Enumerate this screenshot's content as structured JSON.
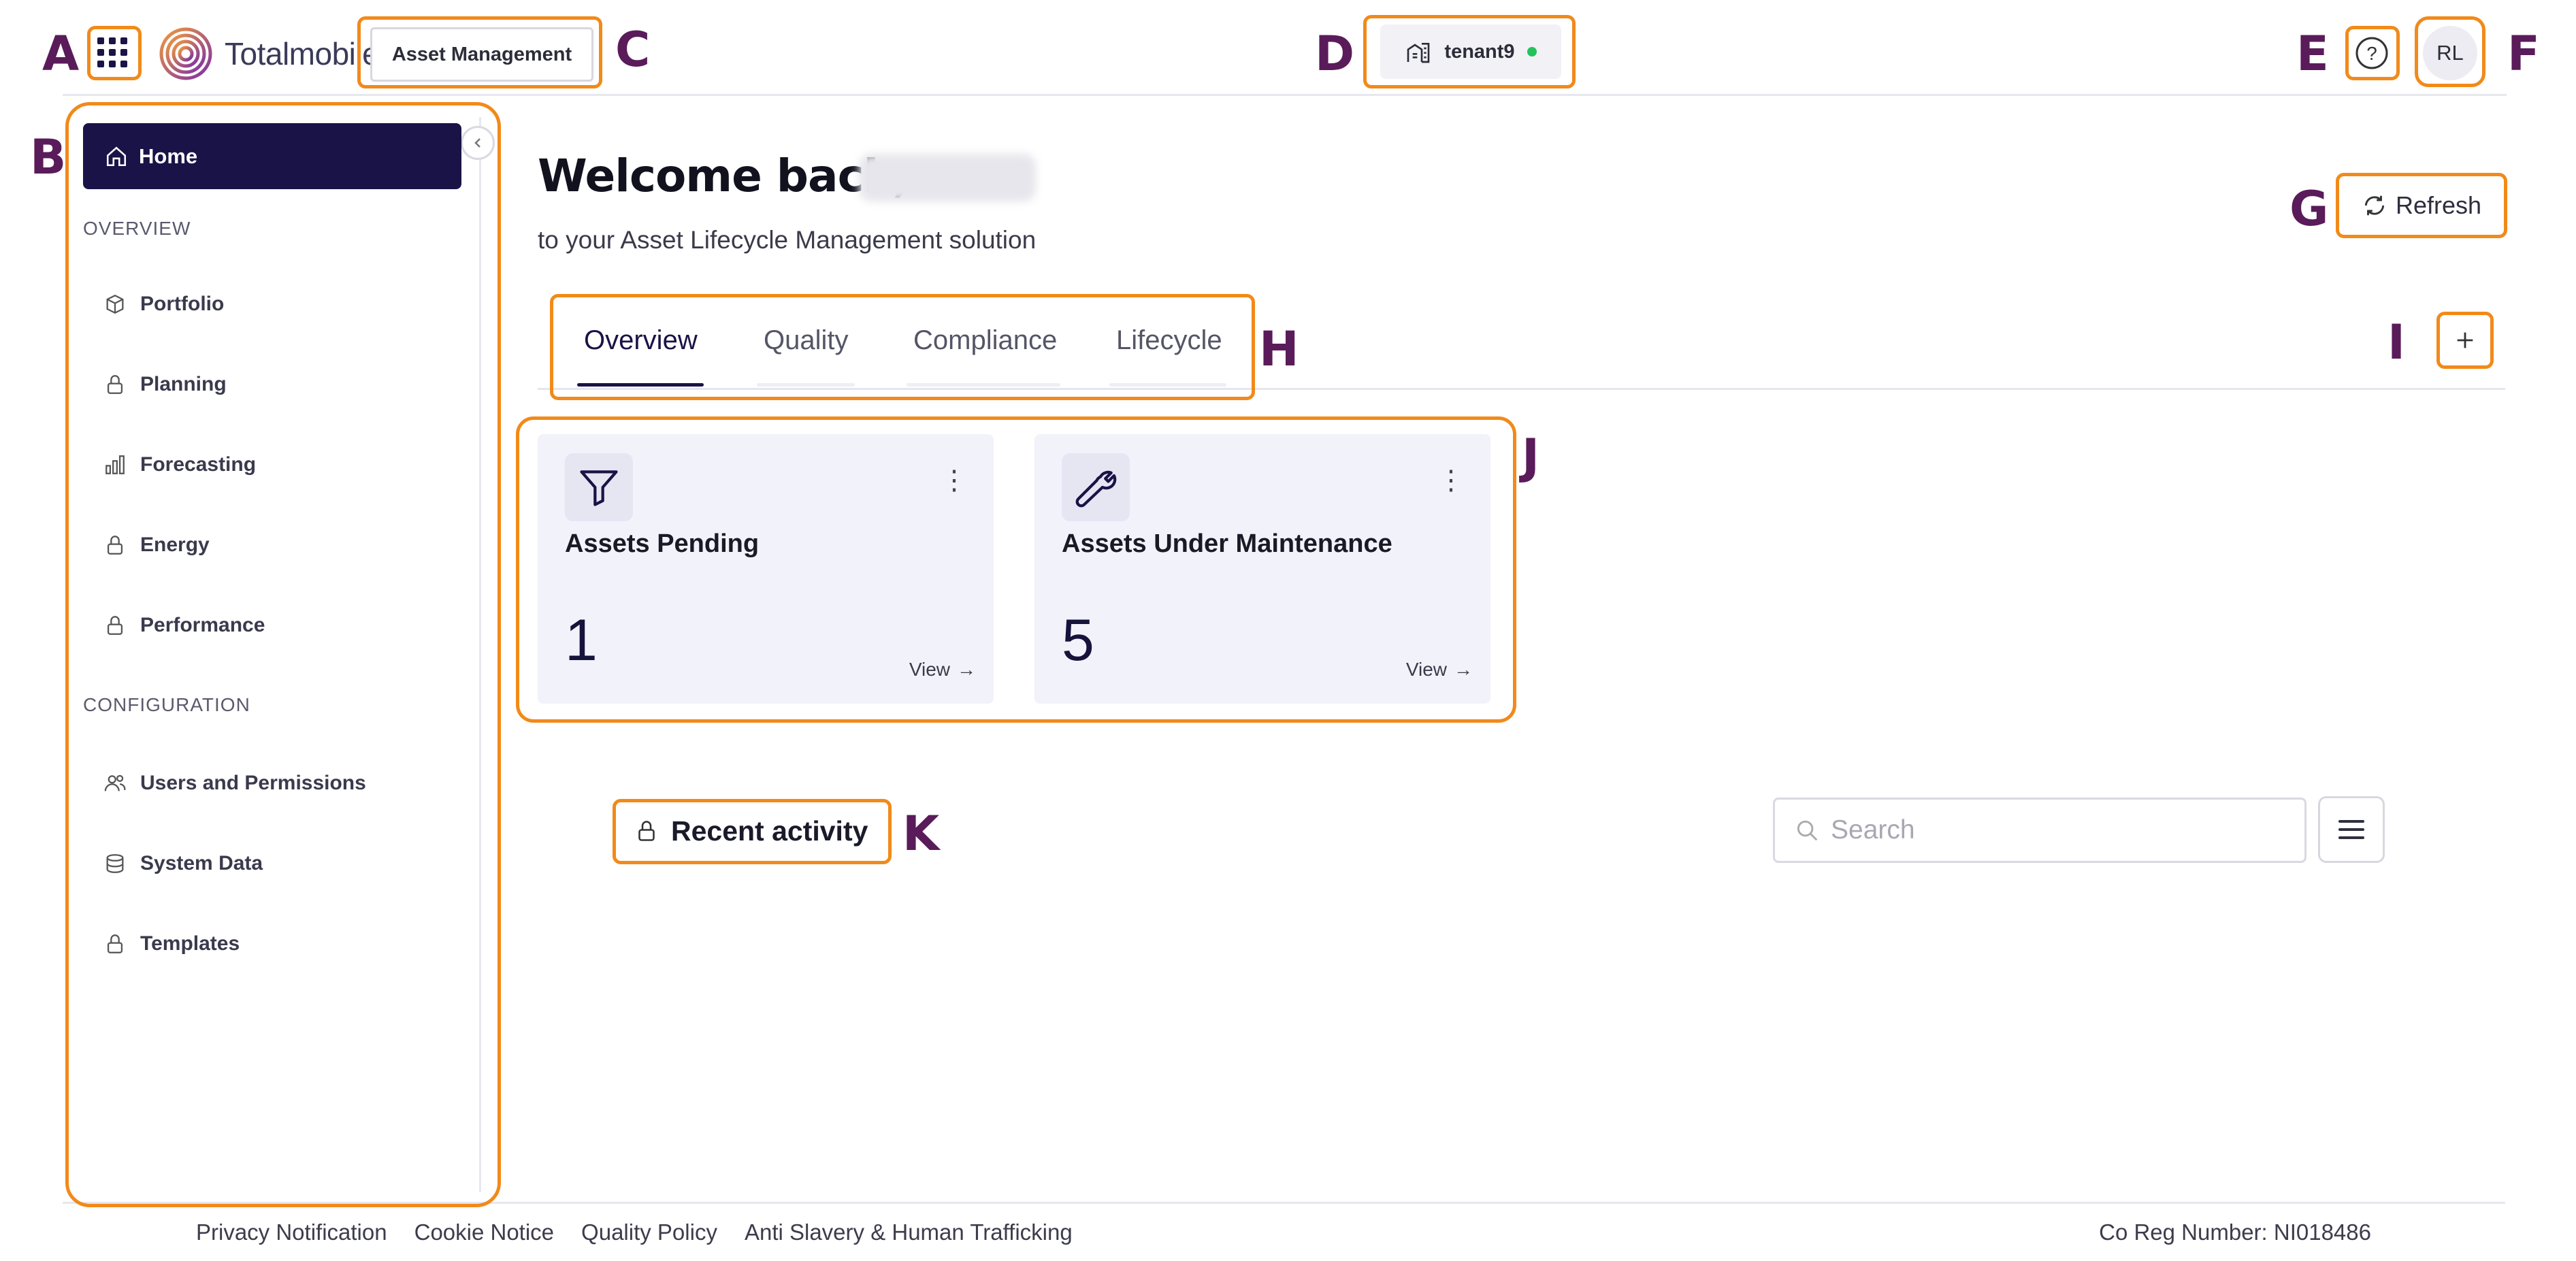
{
  "header": {
    "logo_text": "Totalmobile",
    "app_button": "Asset Management",
    "tenant": "tenant9",
    "avatar_initials": "RL"
  },
  "sidebar": {
    "home": "Home",
    "sections": [
      {
        "title": "OVERVIEW",
        "items": [
          {
            "label": "Portfolio",
            "icon": "box-icon"
          },
          {
            "label": "Planning",
            "icon": "lock-icon"
          },
          {
            "label": "Forecasting",
            "icon": "bar-chart-icon"
          },
          {
            "label": "Energy",
            "icon": "lock-icon"
          },
          {
            "label": "Performance",
            "icon": "lock-icon"
          }
        ]
      },
      {
        "title": "CONFIGURATION",
        "items": [
          {
            "label": "Users and Permissions",
            "icon": "users-icon"
          },
          {
            "label": "System Data",
            "icon": "database-icon"
          },
          {
            "label": "Templates",
            "icon": "lock-icon"
          }
        ]
      }
    ]
  },
  "main": {
    "welcome": "Welcome back,",
    "subtitle": "to your Asset Lifecycle Management solution",
    "refresh": "Refresh",
    "tabs": [
      "Overview",
      "Quality",
      "Compliance",
      "Lifecycle"
    ],
    "active_tab": "Overview",
    "cards": [
      {
        "title": "Assets Pending",
        "value": "1",
        "view": "View",
        "icon": "filter-icon"
      },
      {
        "title": "Assets Under Maintenance",
        "value": "5",
        "view": "View",
        "icon": "wrench-icon"
      }
    ],
    "recent_activity": "Recent activity",
    "search_placeholder": "Search"
  },
  "footer": {
    "links": [
      "Privacy Notification",
      "Cookie Notice",
      "Quality Policy",
      "Anti Slavery & Human Trafficking"
    ],
    "reg_number": "Co Reg Number: NI018486"
  },
  "annotations": {
    "labels": [
      "A",
      "B",
      "C",
      "D",
      "E",
      "F",
      "G",
      "H",
      "I",
      "J",
      "K"
    ]
  },
  "colors": {
    "primary": "#1a1347",
    "highlight": "#f18a1a",
    "label": "#5a1b5a",
    "status_online": "#22c35a"
  }
}
